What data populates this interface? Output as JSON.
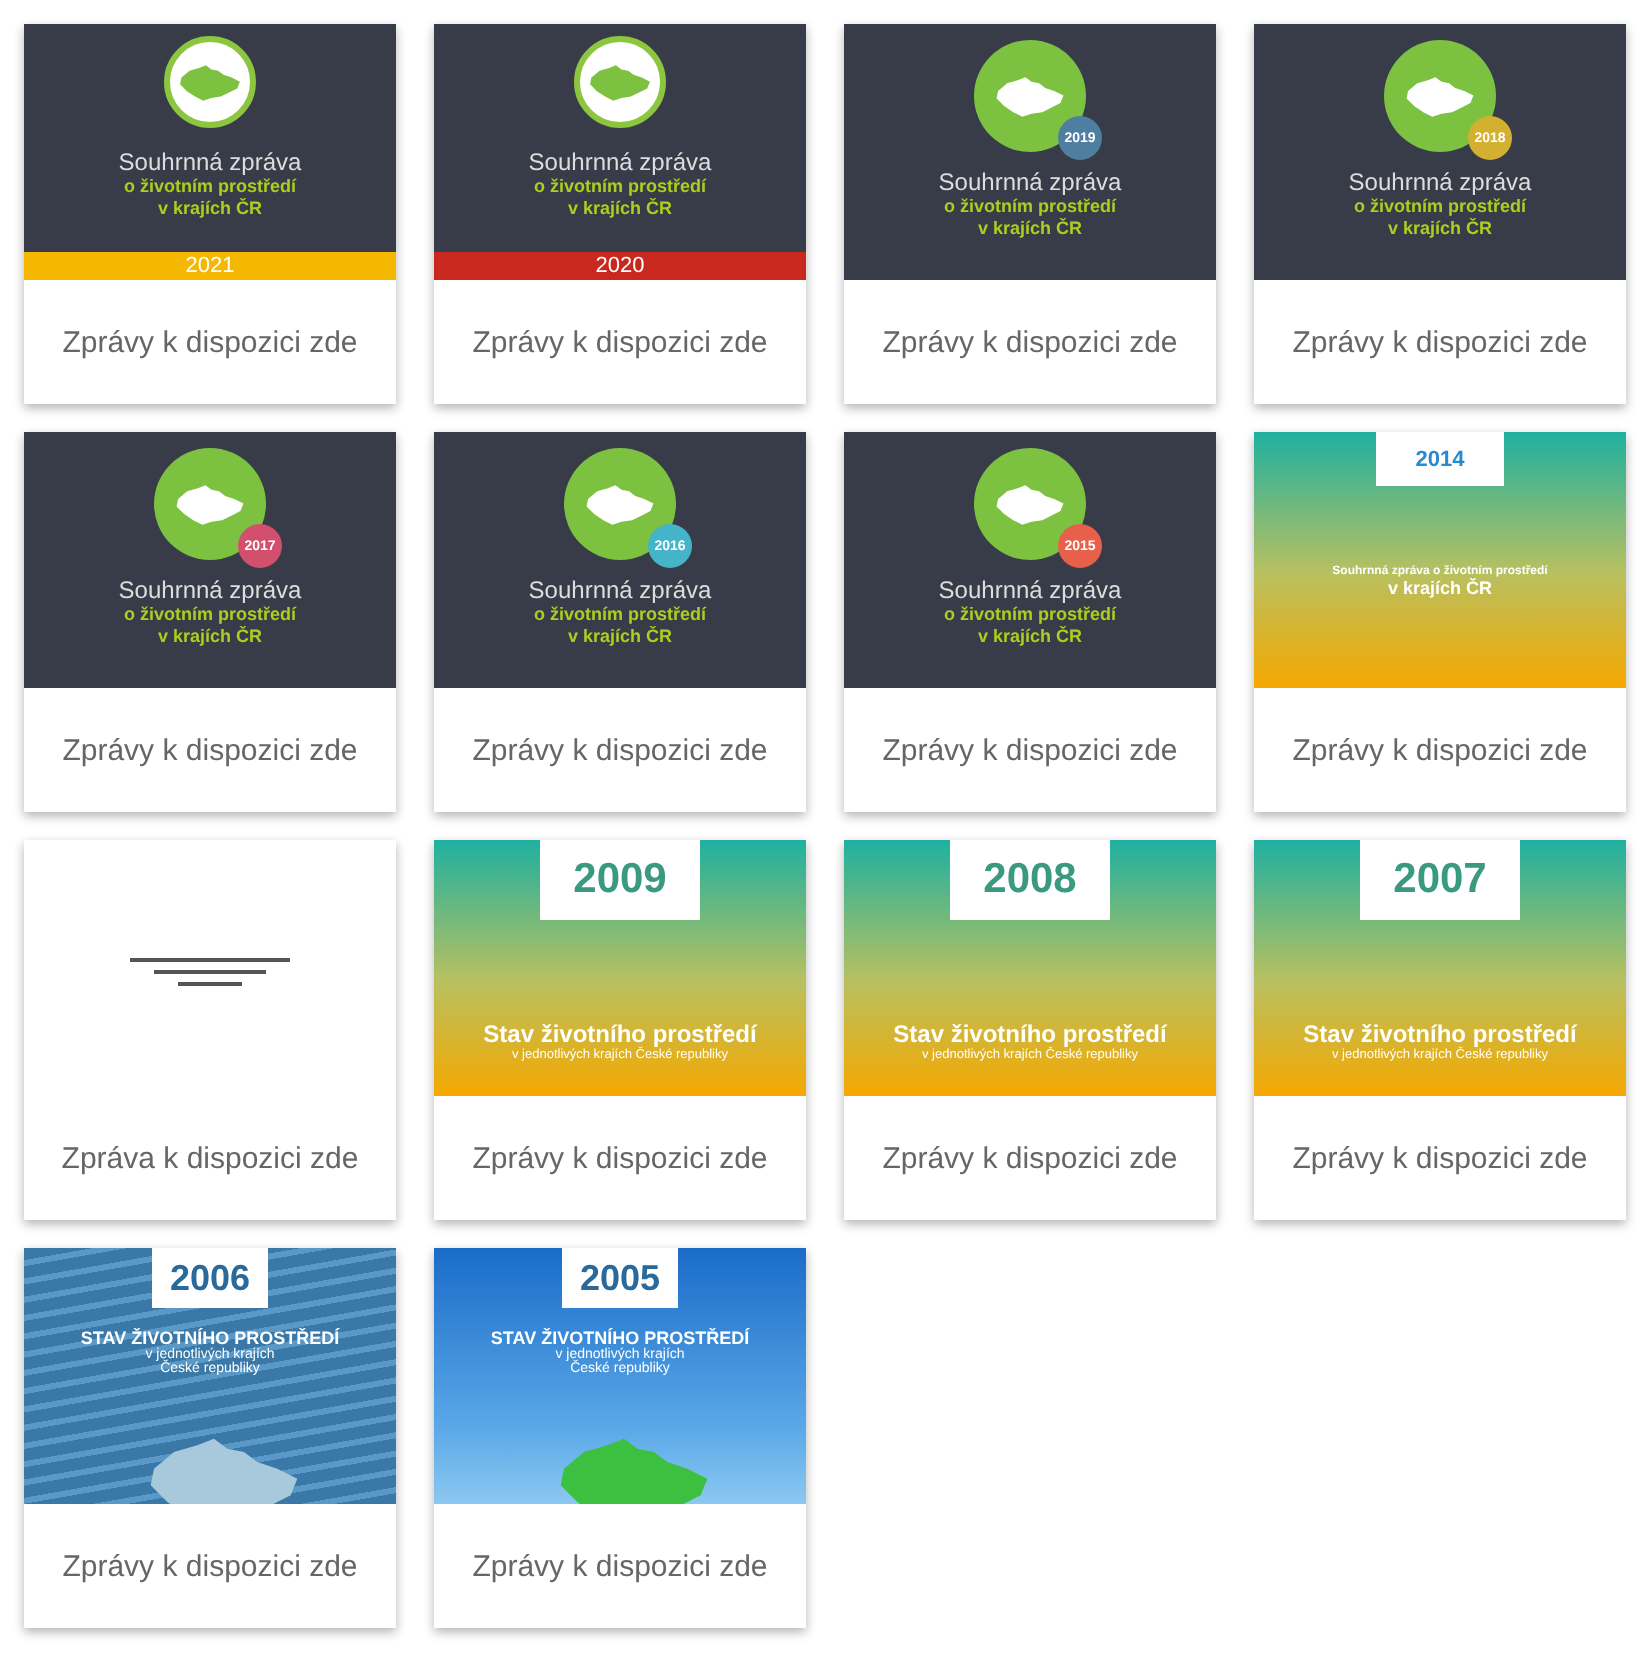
{
  "reports": [
    {
      "cover": {
        "kind": "ring",
        "title": "Souhrnná zpráva",
        "subtitle": "o životním prostředí\nv krajích ČR",
        "year": "2021",
        "color": "#f5b800"
      },
      "link": "Zprávy k dispozici zde"
    },
    {
      "cover": {
        "kind": "ring",
        "title": "Souhrnná zpráva",
        "subtitle": "o životním prostředí\nv krajích ČR",
        "year": "2020",
        "color": "#c8281e"
      },
      "link": "Zprávy k dispozici zde"
    },
    {
      "cover": {
        "kind": "badge",
        "title": "Souhrnná zpráva",
        "subtitle": "o životním prostředí\nv krajích ČR",
        "year": "2019",
        "color": "#4f7fa0"
      },
      "link": "Zprávy k dispozici zde"
    },
    {
      "cover": {
        "kind": "badge",
        "title": "Souhrnná zpráva",
        "subtitle": "o životním prostředí\nv krajích ČR",
        "year": "2018",
        "color": "#d4b030"
      },
      "link": "Zprávy k dispozici zde"
    },
    {
      "cover": {
        "kind": "badge",
        "title": "Souhrnná zpráva",
        "subtitle": "o životním prostředí\nv krajích ČR",
        "year": "2017",
        "color": "#d2506e"
      },
      "link": "Zprávy k dispozici zde"
    },
    {
      "cover": {
        "kind": "badge",
        "title": "Souhrnná zpráva",
        "subtitle": "o životním prostředí\nv krajích ČR",
        "year": "2016",
        "color": "#44b4c8"
      },
      "link": "Zprávy k dispozici zde"
    },
    {
      "cover": {
        "kind": "badge",
        "title": "Souhrnná zpráva",
        "subtitle": "o životním prostředí\nv krajích ČR",
        "year": "2015",
        "color": "#e8604a"
      },
      "link": "Zprávy k dispozici zde"
    },
    {
      "cover": {
        "kind": "gradient-compact",
        "title": "Souhrnná zpráva o životním prostředí",
        "subtitle": "v krajích ČR",
        "year": "2014"
      },
      "link": "Zprávy k dispozici zde"
    },
    {
      "cover": {
        "kind": "blank"
      },
      "link": "Zpráva k dispozici zde"
    },
    {
      "cover": {
        "kind": "gradient",
        "title": "Stav životního prostředí",
        "subtitle": "v jednotlivých krajích České republiky",
        "year": "2009"
      },
      "link": "Zprávy k dispozici zde"
    },
    {
      "cover": {
        "kind": "gradient",
        "title": "Stav životního prostředí",
        "subtitle": "v jednotlivých krajích České republiky",
        "year": "2008"
      },
      "link": "Zprávy k dispozici zde"
    },
    {
      "cover": {
        "kind": "gradient",
        "title": "Stav životního prostředí",
        "subtitle": "v jednotlivých krajích České republiky",
        "year": "2007"
      },
      "link": "Zprávy k dispozici zde"
    },
    {
      "cover": {
        "kind": "photo-water",
        "title": "STAV ŽIVOTNÍHO PROSTŘEDÍ",
        "subtitle": "v jednotlivých krajích\nČeské republiky",
        "year": "2006"
      },
      "link": "Zprávy k dispozici zde"
    },
    {
      "cover": {
        "kind": "photo-sky",
        "title": "STAV ŽIVOTNÍHO PROSTŘEDÍ",
        "subtitle": "v jednotlivých krajích\nČeské republiky",
        "year": "2005"
      },
      "link": "Zprávy k dispozici zde"
    }
  ]
}
